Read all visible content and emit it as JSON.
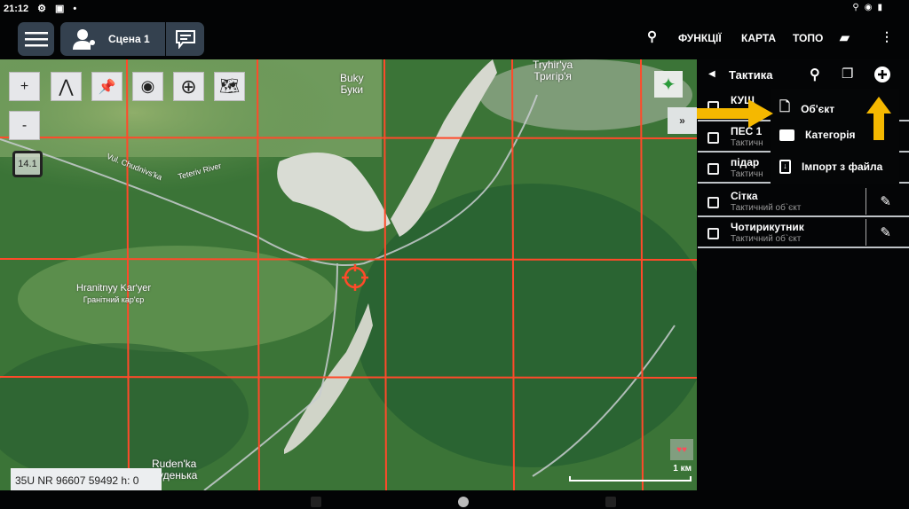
{
  "status_bar": {
    "time": "21:12",
    "left_icons": [
      "gear-icon",
      "image-icon",
      "dot-icon"
    ],
    "right_icons": [
      "location-icon",
      "eye-icon",
      "battery-icon"
    ]
  },
  "top_bar": {
    "scene_label": "Сцена 1",
    "menu": [
      "ФУНКЦІЇ",
      "КАРТА",
      "ТОПО"
    ]
  },
  "map": {
    "zoom_in": "+",
    "zoom_out": "-",
    "zoom_level": "14.1",
    "labels": [
      {
        "en": "Buky",
        "uk": "Буки"
      },
      {
        "en": "Tryhir'ya",
        "uk": "Тригір'я"
      },
      {
        "en": "Hranitnyy Kar'yer",
        "uk": "Гранітний кар'єр"
      },
      {
        "en": "Ruden'ka",
        "uk": "Руденька"
      },
      {
        "en": "Vul. Chudnivs'ka"
      },
      {
        "en": "Teteriv River"
      }
    ],
    "coordinates": "35U NR 96607 59492 h: 0",
    "scale": "1 км",
    "grid_color": "#ff4a2a"
  },
  "panel": {
    "title": "Тактика",
    "items": [
      {
        "title": "КУЩ",
        "subtitle": ""
      },
      {
        "title": "ПЕС 1",
        "subtitle": "Тактичн"
      },
      {
        "title": "підар",
        "subtitle": "Тактичн"
      },
      {
        "title": "Сітка",
        "subtitle": "Тактичний об`єкт"
      },
      {
        "title": "Чотирикутник",
        "subtitle": "Тактичний об`єкт"
      }
    ],
    "add_menu": [
      "Об'єкт",
      "Категорія",
      "Імпорт з файла"
    ]
  },
  "annotation_color": "#f5b800"
}
